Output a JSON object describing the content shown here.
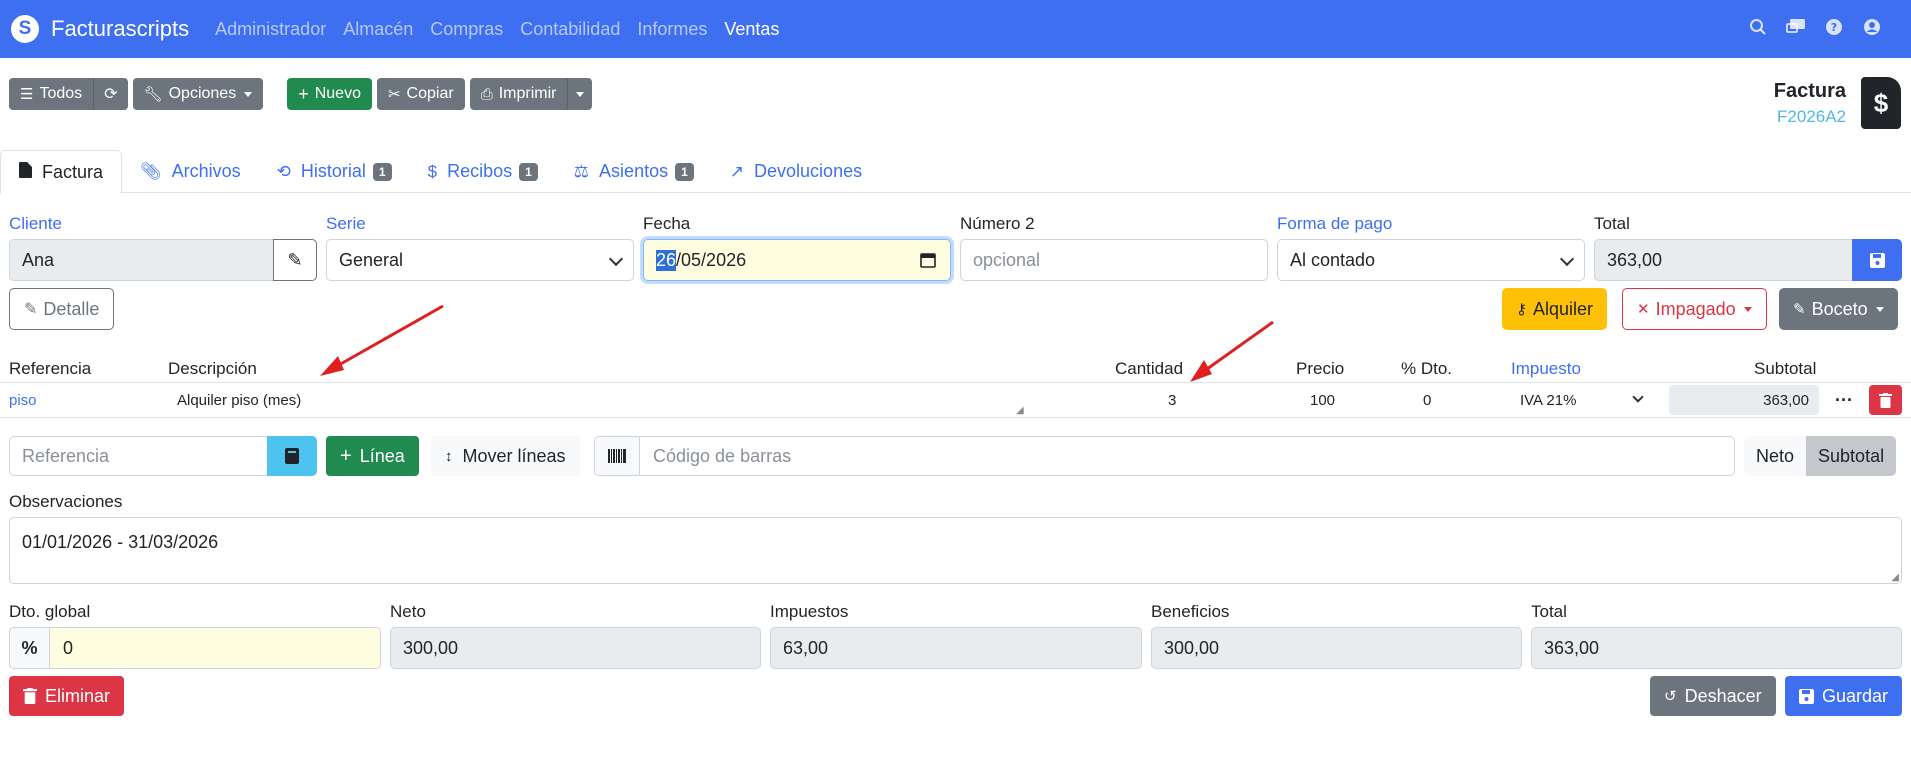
{
  "navbar": {
    "brand": "Facturascripts",
    "brand_logo": "S",
    "links": [
      "Administrador",
      "Almacén",
      "Compras",
      "Contabilidad",
      "Informes",
      "Ventas"
    ],
    "active_link": "Ventas",
    "icons": [
      "search-icon",
      "chat-icon",
      "help-icon",
      "user-icon"
    ]
  },
  "toolbar": {
    "todos": "Todos",
    "opciones": "Opciones",
    "nuevo": "Nuevo",
    "copiar": "Copiar",
    "imprimir": "Imprimir"
  },
  "doc": {
    "title": "Factura",
    "code": "F2026A2"
  },
  "tabs": [
    {
      "label": "Factura",
      "badge": ""
    },
    {
      "label": "Archivos",
      "badge": ""
    },
    {
      "label": "Historial",
      "badge": "1"
    },
    {
      "label": "Recibos",
      "badge": "1"
    },
    {
      "label": "Asientos",
      "badge": "1"
    },
    {
      "label": "Devoluciones",
      "badge": ""
    }
  ],
  "form": {
    "cliente_label": "Cliente",
    "cliente": "Ana",
    "serie_label": "Serie",
    "serie": "General",
    "fecha_label": "Fecha",
    "fecha_sel": "26",
    "fecha_rest": "/05/2026",
    "numero2_label": "Número 2",
    "numero2_placeholder": "opcional",
    "forma_pago_label": "Forma de pago",
    "forma_pago": "Al contado",
    "total_label": "Total",
    "total": "363,00"
  },
  "actions": {
    "detalle": "Detalle",
    "alquiler": "Alquiler",
    "impagado": "Impagado",
    "boceto": "Boceto"
  },
  "lines": {
    "headers": {
      "referencia": "Referencia",
      "descripcion": "Descripción",
      "cantidad": "Cantidad",
      "precio": "Precio",
      "dto": "% Dto.",
      "impuesto": "Impuesto",
      "subtotal": "Subtotal"
    },
    "rows": [
      {
        "referencia": "piso",
        "descripcion": "Alquiler piso (mes)",
        "cantidad": "3",
        "precio": "100",
        "dto": "0",
        "impuesto": "IVA 21%",
        "subtotal": "363,00"
      }
    ]
  },
  "add_line": {
    "referencia_placeholder": "Referencia",
    "linea": "Línea",
    "mover_lineas": "Mover líneas",
    "barcode_placeholder": "Código de barras",
    "neto": "Neto",
    "subtotal": "Subtotal"
  },
  "observaciones": {
    "label": "Observaciones",
    "value": "01/01/2026 - 31/03/2026"
  },
  "totals": {
    "dto_global_label": "Dto. global",
    "dto_global": "0",
    "dto_symbol": "%",
    "neto_label": "Neto",
    "neto": "300,00",
    "impuestos_label": "Impuestos",
    "impuestos": "63,00",
    "beneficios_label": "Beneficios",
    "beneficios": "300,00",
    "total_label": "Total",
    "total": "363,00"
  },
  "footer": {
    "eliminar": "Eliminar",
    "deshacer": "Deshacer",
    "guardar": "Guardar"
  },
  "colors": {
    "primary": "#3e6ff0",
    "success": "#218a4f",
    "danger": "#dc3545",
    "warning": "#ffc107",
    "secondary": "#6c757d",
    "info": "#4fc3f0",
    "annotation": "#e02020"
  }
}
